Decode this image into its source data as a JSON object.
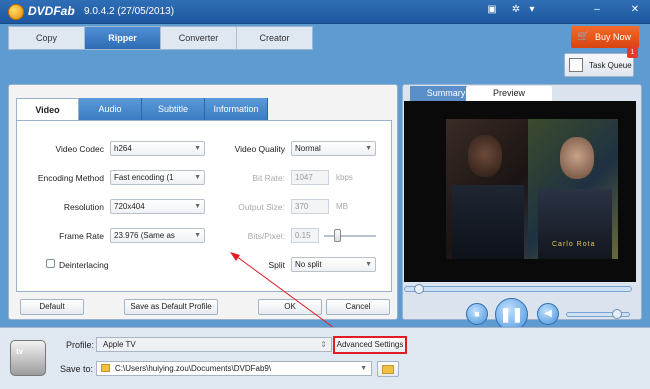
{
  "app": {
    "brand": "DVDFab",
    "version": "9.0.4.2 (27/05/2013)"
  },
  "titlebar_icons": [
    "flag-icon",
    "settings-icon",
    "help-icon",
    "minimize-icon",
    "close-icon"
  ],
  "main_tabs": [
    {
      "label": "Copy"
    },
    {
      "label": "Ripper"
    },
    {
      "label": "Converter"
    },
    {
      "label": "Creator"
    }
  ],
  "active_main_tab": "Ripper",
  "buy_now": {
    "label": "Buy Now"
  },
  "task_queue": {
    "label": "Task Queue",
    "badge": "1"
  },
  "setting_tabs": [
    {
      "label": "Video"
    },
    {
      "label": "Audio"
    },
    {
      "label": "Subtitle"
    },
    {
      "label": "Information"
    }
  ],
  "video": {
    "codec": {
      "label": "Video Codec",
      "value": "h264"
    },
    "encoding": {
      "label": "Encoding Method",
      "value": "Fast encoding (1"
    },
    "resolution": {
      "label": "Resolution",
      "value": "720x404"
    },
    "frame_rate": {
      "label": "Frame Rate",
      "value": "23.976 (Same as"
    },
    "deinterlacing": {
      "label": "Deinterlacing",
      "checked": false
    },
    "quality": {
      "label": "Video Quality",
      "value": "Normal"
    },
    "bit_rate": {
      "label": "Bit Rate:",
      "value": "1047",
      "unit": "kbps"
    },
    "output_size": {
      "label": "Output Size:",
      "value": "370",
      "unit": "MB"
    },
    "bits_pixel": {
      "label": "Bits/Pixel:",
      "value": "0.15"
    },
    "split": {
      "label": "Split",
      "value": "No split"
    }
  },
  "buttons": {
    "default": "Default",
    "save_default": "Save as Default Profile",
    "ok": "OK",
    "cancel": "Cancel"
  },
  "preview_tabs": [
    {
      "label": "Summary"
    },
    {
      "label": "Preview"
    }
  ],
  "active_preview_tab": "Preview",
  "video_caption": "Carlo Rota",
  "player": {
    "seek_fraction": 0.07,
    "volume_fraction": 0.8
  },
  "profile": {
    "label": "Profile:",
    "value": "Apple TV",
    "advanced_label": "Advanced Settings"
  },
  "save_to": {
    "label": "Save to:",
    "value": "C:\\Users\\huiying.zou\\Documents\\DVDFab9\\"
  },
  "colors": {
    "accent_blue": "#2e6cb5",
    "buy_orange": "#e35118",
    "highlight_red": "#e11c24"
  }
}
